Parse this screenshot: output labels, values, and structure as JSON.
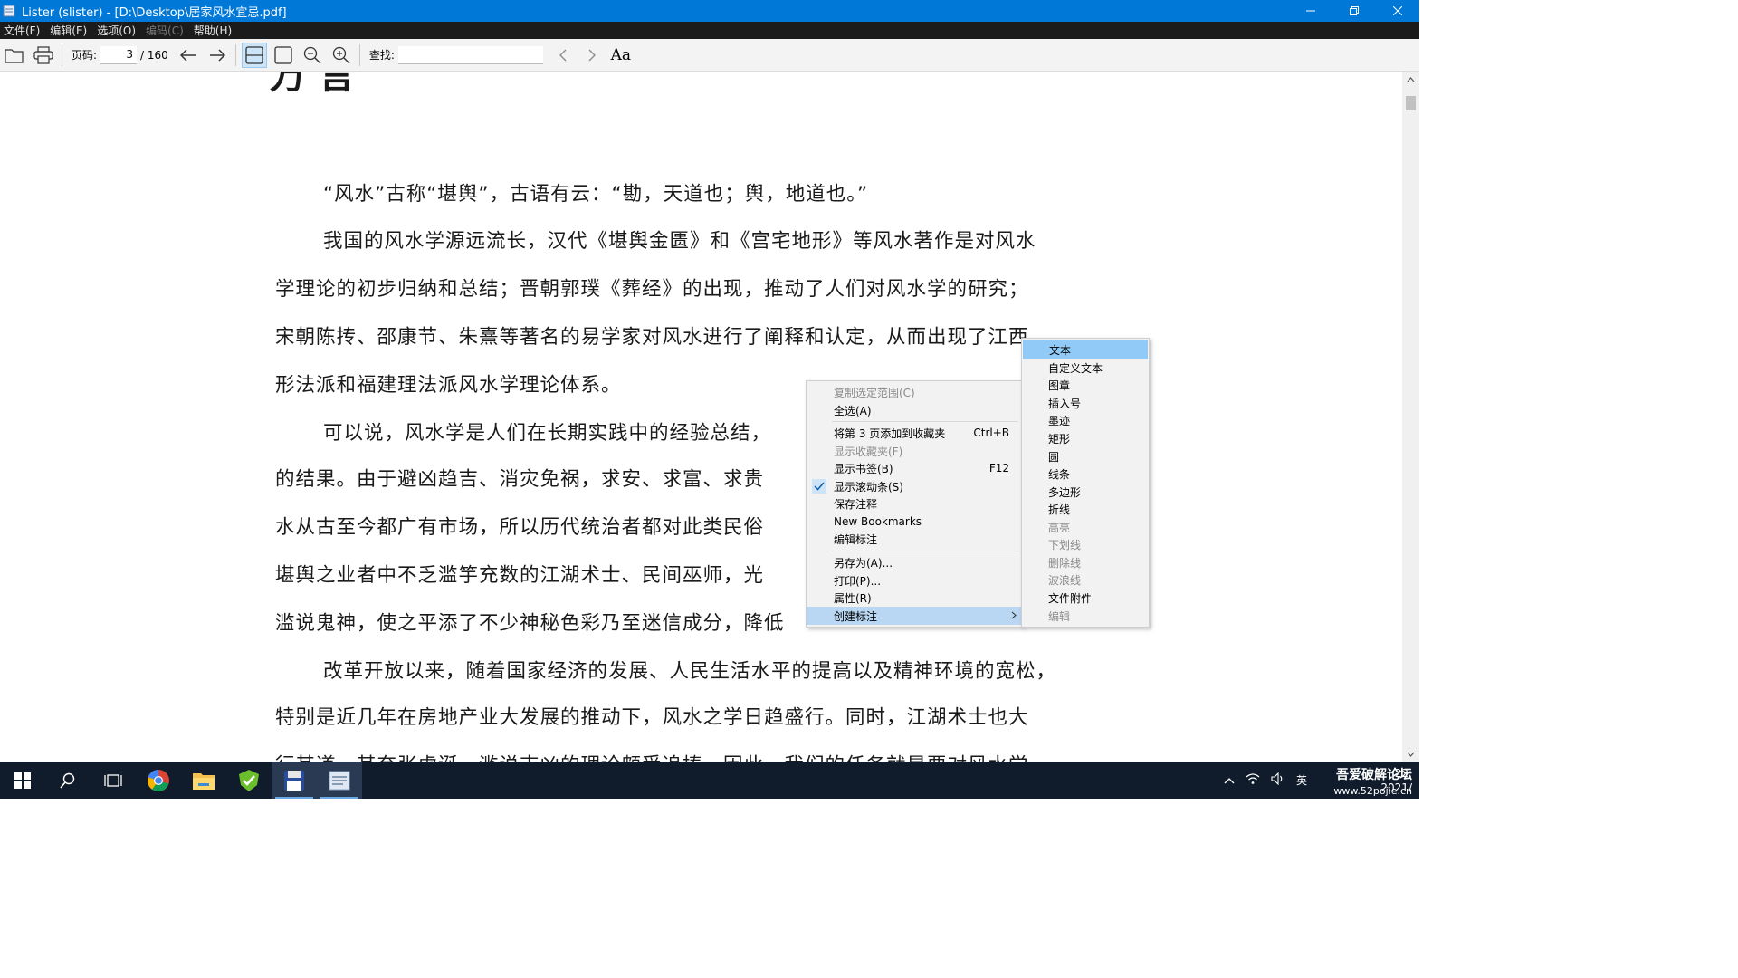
{
  "window": {
    "title": "Lister (slister) - [D:\\Desktop\\居家风水宜忌.pdf]",
    "controls": [
      "minimize-icon",
      "restore-icon",
      "close-icon"
    ]
  },
  "menubar": {
    "items": [
      {
        "label": "文件(F)",
        "enabled": true
      },
      {
        "label": "编辑(E)",
        "enabled": true
      },
      {
        "label": "选项(O)",
        "enabled": true
      },
      {
        "label": "编码(C)",
        "enabled": false
      },
      {
        "label": "帮助(H)",
        "enabled": true
      }
    ]
  },
  "toolbar": {
    "page_label": "页码:",
    "page_current": "3",
    "page_total": "/ 160",
    "find_label": "查找:",
    "find_value": "",
    "font_button": "Aa"
  },
  "document": {
    "heading_fragment": "万 言",
    "paragraphs": [
      "“风水”古称“堪舆”，古语有云：“勘，天道也；舆，地道也。”",
      "我国的风水学源远流长，汉代《堪舆金匮》和《宫宅地形》等风水著作是对风水",
      "学理论的初步归纳和总结；晋朝郭璞《葬经》的出现，推动了人们对风水学的研究；",
      "宋朝陈抟、邵康节、朱熹等著名的易学家对风水进行了阐释和认定，从而出现了江西",
      "形法派和福建理法派风水学理论体系。",
      "可以说，风水学是人们在长期实践中的经验总结，",
      "的结果。由于避凶趋吉、消灾免祸，求安、求富、求贵",
      "水从古至今都广有市场，所以历代统治者都对此类民俗",
      "堪舆之业者中不乏滥竽充数的江湖术士、民间巫师，光",
      "滥说鬼神，使之平添了不少神秘色彩乃至迷信成分，降低",
      "改革开放以来，随着国家经济的发展、人民生活水平的提高以及精神环境的宽松，",
      "特别是近几年在房地产业大发展的推动下，风水之学日趋盛行。同时，江湖术士也大",
      "行其道，其夸张虚诞、滥说吉凶的理论颇受追捧，因此，我们的任务就是要对风水学"
    ]
  },
  "context_menu": {
    "items": [
      {
        "label": "复制选定范围(C)",
        "enabled": false,
        "shortcut": ""
      },
      {
        "label": "全选(A)",
        "enabled": true,
        "shortcut": ""
      },
      {
        "label": "将第 3 页添加到收藏夹",
        "enabled": true,
        "shortcut": "Ctrl+B"
      },
      {
        "label": "显示收藏夹(F)",
        "enabled": false,
        "shortcut": ""
      },
      {
        "label": "显示书签(B)",
        "enabled": true,
        "shortcut": "F12"
      },
      {
        "label": "显示滚动条(S)",
        "enabled": true,
        "shortcut": "",
        "checked": true
      },
      {
        "label": "保存注释",
        "enabled": true,
        "shortcut": ""
      },
      {
        "label": "New Bookmarks",
        "enabled": true,
        "shortcut": ""
      },
      {
        "label": "编辑标注",
        "enabled": true,
        "shortcut": ""
      },
      {
        "label": "另存为(A)...",
        "enabled": true,
        "shortcut": ""
      },
      {
        "label": "打印(P)...",
        "enabled": true,
        "shortcut": ""
      },
      {
        "label": "属性(R)",
        "enabled": true,
        "shortcut": ""
      },
      {
        "label": "创建标注",
        "enabled": true,
        "shortcut": "",
        "submenu": true,
        "highlighted": true
      }
    ]
  },
  "submenu": {
    "items": [
      {
        "label": "文本",
        "enabled": true,
        "highlighted": true
      },
      {
        "label": "自定义文本",
        "enabled": true
      },
      {
        "label": "图章",
        "enabled": true
      },
      {
        "label": "插入号",
        "enabled": true
      },
      {
        "label": "墨迹",
        "enabled": true
      },
      {
        "label": "矩形",
        "enabled": true
      },
      {
        "label": "圆",
        "enabled": true
      },
      {
        "label": "线条",
        "enabled": true
      },
      {
        "label": "多边形",
        "enabled": true
      },
      {
        "label": "折线",
        "enabled": true
      },
      {
        "label": "高亮",
        "enabled": false
      },
      {
        "label": "下划线",
        "enabled": false
      },
      {
        "label": "删除线",
        "enabled": false
      },
      {
        "label": "波浪线",
        "enabled": false
      },
      {
        "label": "文件附件",
        "enabled": true
      },
      {
        "label": "编辑",
        "enabled": false
      }
    ]
  },
  "taskbar": {
    "apps": [
      "windows-start-icon",
      "search-icon",
      "task-view-icon",
      "chrome-icon",
      "file-explorer-icon",
      "green-shield-app-icon",
      "floppy-save-app-icon",
      "lister-app-icon"
    ],
    "tray_ime": "英",
    "clock_time": "22:",
    "clock_date": "2021/",
    "watermark_line1": "吾爱破解论坛",
    "watermark_line2": "www.52pojie.cn"
  },
  "colors": {
    "titlebar": "#0078d7",
    "menubar": "#1b1b1b",
    "menu_highlight": "#b9d7f2",
    "submenu_highlight": "#91c9f7",
    "taskbar": "#101c2c"
  }
}
